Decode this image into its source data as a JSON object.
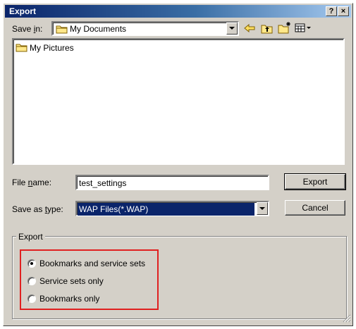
{
  "window": {
    "title": "Export",
    "help_button": "?",
    "close_button": "×"
  },
  "save_in": {
    "label_pre": "Save ",
    "label_key": "i",
    "label_post": "n:",
    "value": "My Documents",
    "icons": [
      "back-arrow-icon",
      "up-folder-icon",
      "new-folder-icon",
      "view-menu-icon"
    ]
  },
  "file_list": {
    "items": [
      {
        "name": "My Pictures",
        "icon": "folder-icon"
      }
    ]
  },
  "file_name": {
    "label_pre": "File ",
    "label_key": "n",
    "label_post": "ame:",
    "value": "test_settings"
  },
  "save_as_type": {
    "label_pre": "Save as ",
    "label_key": "t",
    "label_post": "ype:",
    "value": "WAP Files(*.WAP)"
  },
  "buttons": {
    "export": "Export",
    "cancel": "Cancel"
  },
  "export_group": {
    "title": "Export",
    "options": [
      {
        "label": "Bookmarks and service sets",
        "checked": true
      },
      {
        "label": "Service sets only",
        "checked": false
      },
      {
        "label": "Bookmarks only",
        "checked": false
      }
    ]
  },
  "colors": {
    "title_bar": "#0a246a",
    "selection": "#0a246a",
    "highlight_box": "#e02020"
  }
}
